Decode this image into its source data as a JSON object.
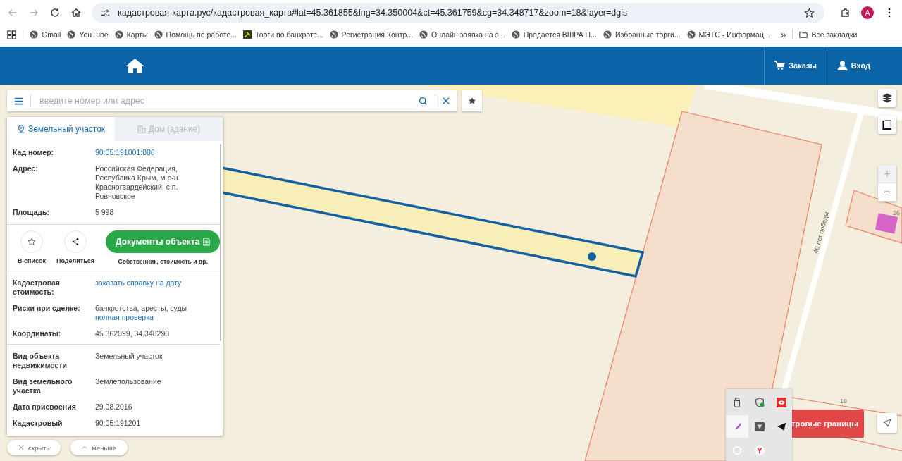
{
  "browser": {
    "url": "кадастровая-карта.рус/кадастровая_карта#lat=45.361855&lng=34.350004&ct=45.361759&cg=34.348717&zoom=18&layer=dgis",
    "profile_initial": "A",
    "bookmarks": [
      {
        "label": "Gmail",
        "kind": "globe"
      },
      {
        "label": "YouTube",
        "kind": "globe"
      },
      {
        "label": "Карты",
        "kind": "globe"
      },
      {
        "label": "Помощь по работе...",
        "kind": "globe"
      },
      {
        "label": "Торги по банкротс...",
        "kind": "hammer"
      },
      {
        "label": "Регистрация Контр...",
        "kind": "globe"
      },
      {
        "label": "Онлайн заявка на э...",
        "kind": "globe"
      },
      {
        "label": "Продается ВШРА П...",
        "kind": "globe"
      },
      {
        "label": "Избранные торги...",
        "kind": "globe"
      },
      {
        "label": "МЭТС - Информац...",
        "kind": "globe"
      }
    ],
    "bookmarks_more": "»",
    "all_bookmarks": "Все закладки"
  },
  "header": {
    "orders": "Заказы",
    "login": "Вход"
  },
  "search": {
    "placeholder": "введите номер или адрес"
  },
  "panel": {
    "tabs": [
      {
        "label": "Земельный участок",
        "selected": true
      },
      {
        "label": "Дом (здание)",
        "selected": false
      }
    ],
    "sections": [
      [
        {
          "label": "Кад.номер:",
          "parts": [
            {
              "kind": "link",
              "text": "90:05:191001:886"
            }
          ]
        },
        {
          "label": "Адрес:",
          "parts": [
            {
              "kind": "text",
              "text": "Российская Федерация, Республика Крым, м.р-н Красногвардейский, с.п. Ровновское"
            }
          ]
        },
        {
          "label": "Площадь:",
          "parts": [
            {
              "kind": "text",
              "text": "5 998"
            }
          ]
        }
      ],
      [
        {
          "label": "Кадастровая стоимость:",
          "parts": [
            {
              "kind": "link",
              "text": "заказать справку на дату"
            }
          ]
        },
        {
          "label": "Риски при сделке:",
          "parts": [
            {
              "kind": "text",
              "text": "банкротства, аресты, суды"
            },
            {
              "kind": "link",
              "text": "полная проверка"
            }
          ]
        },
        {
          "label": "Координаты:",
          "parts": [
            {
              "kind": "text",
              "text": "45.362099, 34.348298"
            }
          ]
        }
      ],
      [
        {
          "label": "Вид объекта недвижимости",
          "parts": [
            {
              "kind": "text",
              "text": "Земельный участок"
            }
          ]
        },
        {
          "label": "Вид земельного участка",
          "parts": [
            {
              "kind": "text",
              "text": "Землепользование"
            }
          ]
        },
        {
          "label": "Дата присвоения",
          "parts": [
            {
              "kind": "text",
              "text": "29.08.2016"
            }
          ]
        },
        {
          "label": "Кадастровый",
          "parts": [
            {
              "kind": "text",
              "text": "90:05:191201"
            }
          ]
        }
      ]
    ],
    "actions": {
      "favorite": "В список",
      "share": "Поделиться",
      "documents": "Документы объекта",
      "documents_note": "Собственник, стоимость и др."
    }
  },
  "bottom_buttons": [
    {
      "kind": "close",
      "label": "скрыть"
    },
    {
      "kind": "collapse",
      "label": "меньше"
    }
  ],
  "map": {
    "street": "40 лет победы",
    "plot_numbers": [
      "26",
      "19"
    ],
    "zoom": [
      {
        "label": "+",
        "disabled": true
      },
      {
        "label": "−",
        "disabled": false
      }
    ],
    "boundaries_button": "тровые границы"
  }
}
